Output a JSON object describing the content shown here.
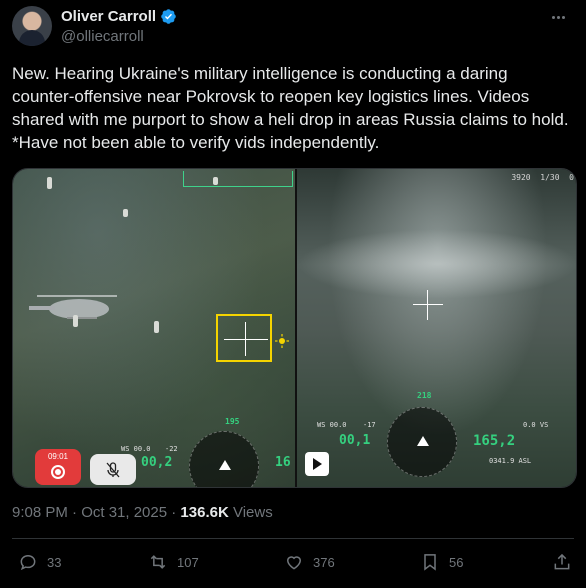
{
  "author": {
    "name": "Oliver Carroll",
    "handle": "@olliecarroll"
  },
  "tweet": {
    "text": "New. Hearing Ukraine's military intelligence is conducting a daring counter-offensive near Pokrovsk to reopen key logistics lines. Videos shared with me purport to show a heli drop in areas Russia claims to hold. *Have not been able to verify vids independently."
  },
  "media": {
    "left_video": {
      "rec_time": "09:01",
      "hud_speed": "00,2",
      "hud_heading": "195",
      "hud_alt": "16",
      "hud_ws": "WS 00.0",
      "hud_tilt": "-22"
    },
    "right_video": {
      "hud_top": "3920",
      "hud_top2": "1/30",
      "hud_top3": "0",
      "hud_speed": "00,1",
      "hud_heading": "218",
      "hud_alt": "165,2",
      "hud_ws": "WS 00.0",
      "hud_tilt": "-17",
      "hud_asl": "0341.9 ASL",
      "hud_vs": "0.0 VS"
    }
  },
  "meta": {
    "time": "9:08 PM · Oct 31, 2025 · ",
    "views_count": "136.6K",
    "views_label": " Views"
  },
  "actions": {
    "replies": "33",
    "reposts": "107",
    "likes": "376",
    "bookmarks": "56"
  },
  "colors": {
    "accent": "#1d9bf0",
    "muted": "#71767b",
    "hud_green": "#35d07f",
    "rec_red": "#e23b3b"
  }
}
